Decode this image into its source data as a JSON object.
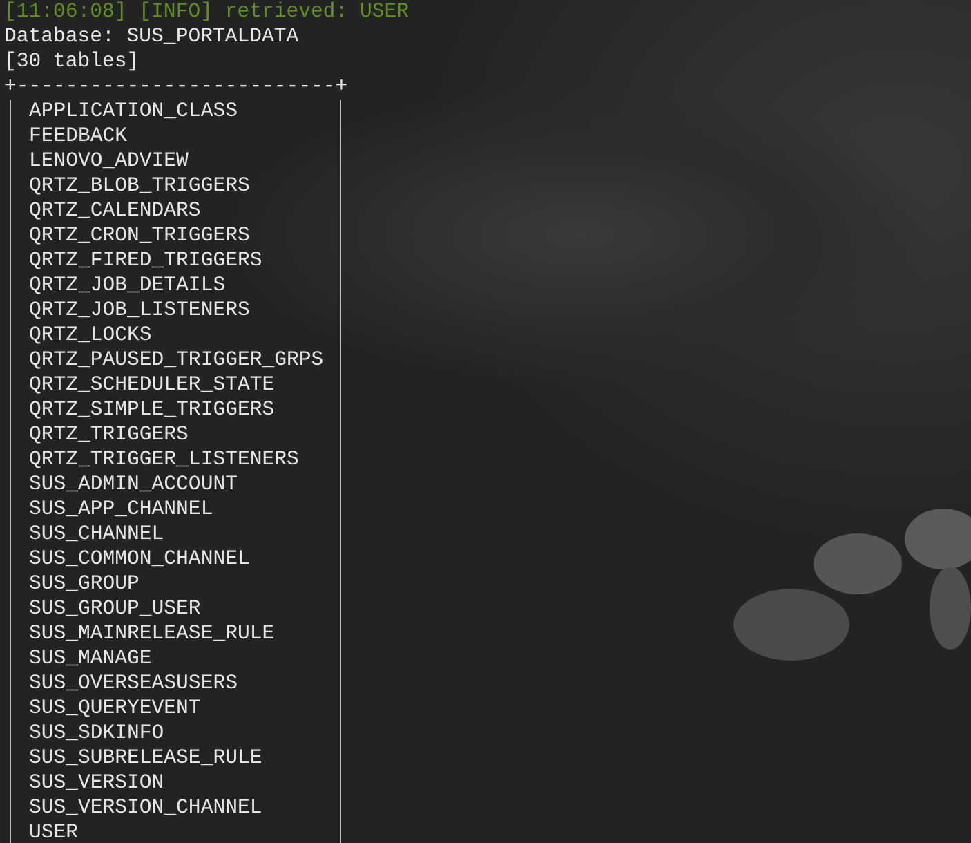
{
  "log_line": "[11:06:08] [INFO] retrieved: USER",
  "database_line": "Database: SUS_PORTALDATA",
  "count_line": "[30 tables]",
  "table": {
    "border": "+--------------------------+",
    "rows": [
      "APPLICATION_CLASS",
      "FEEDBACK",
      "LENOVO_ADVIEW",
      "QRTZ_BLOB_TRIGGERS",
      "QRTZ_CALENDARS",
      "QRTZ_CRON_TRIGGERS",
      "QRTZ_FIRED_TRIGGERS",
      "QRTZ_JOB_DETAILS",
      "QRTZ_JOB_LISTENERS",
      "QRTZ_LOCKS",
      "QRTZ_PAUSED_TRIGGER_GRPS",
      "QRTZ_SCHEDULER_STATE",
      "QRTZ_SIMPLE_TRIGGERS",
      "QRTZ_TRIGGERS",
      "QRTZ_TRIGGER_LISTENERS",
      "SUS_ADMIN_ACCOUNT",
      "SUS_APP_CHANNEL",
      "SUS_CHANNEL",
      "SUS_COMMON_CHANNEL",
      "SUS_GROUP",
      "SUS_GROUP_USER",
      "SUS_MAINRELEASE_RULE",
      "SUS_MANAGE",
      "SUS_OVERSEASUSERS",
      "SUS_QUERYEVENT",
      "SUS_SDKINFO",
      "SUS_SUBRELEASE_RULE",
      "SUS_VERSION",
      "SUS_VERSION_CHANNEL",
      "USER"
    ]
  }
}
